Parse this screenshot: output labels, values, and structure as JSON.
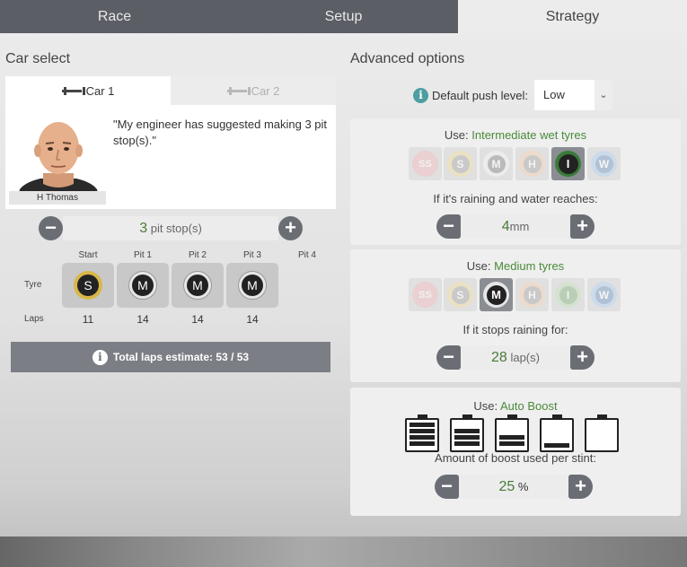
{
  "tabs": {
    "race": "Race",
    "setup": "Setup",
    "strategy": "Strategy"
  },
  "car_select": {
    "title": "Car select",
    "car1": "Car 1",
    "car2": "Car 2",
    "driver": "H Thomas",
    "quote": "\"My engineer has suggested making 3 pit stop(s).\""
  },
  "pit_stops": {
    "count": "3",
    "unit": "pit stop(s)",
    "minus": "−",
    "plus": "+"
  },
  "strategy": {
    "columns": [
      "Start",
      "Pit 1",
      "Pit 2",
      "Pit 3",
      "Pit 4"
    ],
    "row_tyre": "Tyre",
    "row_laps": "Laps",
    "tyres": [
      "S",
      "M",
      "M",
      "M"
    ],
    "laps": [
      "11",
      "14",
      "14",
      "14"
    ],
    "total": "Total laps estimate: 53 / 53"
  },
  "advanced": {
    "title": "Advanced options",
    "push_label": "Default push level:",
    "push_value": "Low",
    "wet": {
      "use_label": "Use:",
      "use_value": "Intermediate wet tyres",
      "tyres": [
        "SS",
        "S",
        "M",
        "H",
        "I",
        "W"
      ],
      "selected": "I",
      "question": "If it's raining and water reaches:",
      "value": "4",
      "unit": "mm"
    },
    "dry": {
      "use_label": "Use:",
      "use_value": "Medium tyres",
      "tyres": [
        "SS",
        "S",
        "M",
        "H",
        "I",
        "W"
      ],
      "selected": "M",
      "question": "If it stops raining for:",
      "value": "28",
      "unit": "lap(s)"
    },
    "boost": {
      "use_label": "Use:",
      "use_value": "Auto Boost",
      "levels": [
        4,
        3,
        2,
        1,
        0
      ],
      "question": "Amount of boost used per stint:",
      "value": "25",
      "unit": "%"
    }
  },
  "colors": {
    "soft": "#d9b64a",
    "medium": "#e0e0e0",
    "intermediate": "#3a7a3a",
    "accent_green": "#4a8a3a",
    "button_gray": "#6a6e74"
  }
}
